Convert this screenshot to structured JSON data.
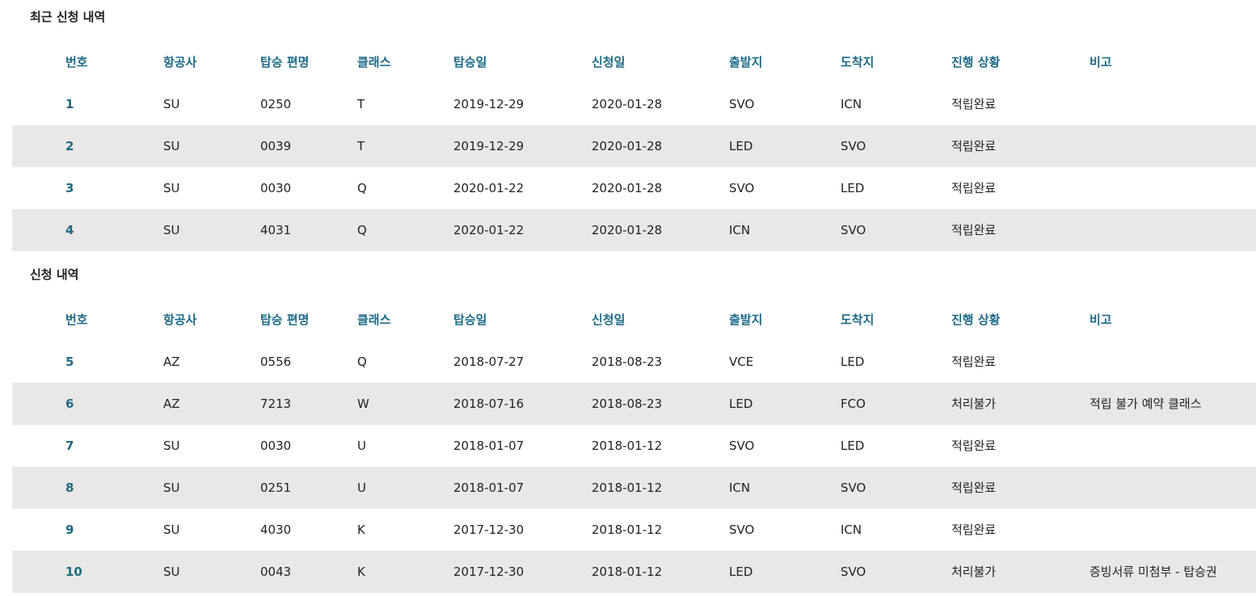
{
  "columns": [
    "번호",
    "항공사",
    "탑승 편명",
    "클래스",
    "탑승일",
    "신청일",
    "출발지",
    "도착지",
    "진행 상황",
    "비고"
  ],
  "recent": {
    "title": "최근 신청 내역",
    "rows": [
      {
        "no": "1",
        "airline": "SU",
        "flight": "0250",
        "class": "T",
        "boarding_date": "2019-12-29",
        "request_date": "2020-01-28",
        "origin": "SVO",
        "destination": "ICN",
        "status": "적립완료",
        "note": ""
      },
      {
        "no": "2",
        "airline": "SU",
        "flight": "0039",
        "class": "T",
        "boarding_date": "2019-12-29",
        "request_date": "2020-01-28",
        "origin": "LED",
        "destination": "SVO",
        "status": "적립완료",
        "note": ""
      },
      {
        "no": "3",
        "airline": "SU",
        "flight": "0030",
        "class": "Q",
        "boarding_date": "2020-01-22",
        "request_date": "2020-01-28",
        "origin": "SVO",
        "destination": "LED",
        "status": "적립완료",
        "note": ""
      },
      {
        "no": "4",
        "airline": "SU",
        "flight": "4031",
        "class": "Q",
        "boarding_date": "2020-01-22",
        "request_date": "2020-01-28",
        "origin": "ICN",
        "destination": "SVO",
        "status": "적립완료",
        "note": ""
      }
    ]
  },
  "history": {
    "title": "신청 내역",
    "rows": [
      {
        "no": "5",
        "airline": "AZ",
        "flight": "0556",
        "class": "Q",
        "boarding_date": "2018-07-27",
        "request_date": "2018-08-23",
        "origin": "VCE",
        "destination": "LED",
        "status": "적립완료",
        "note": ""
      },
      {
        "no": "6",
        "airline": "AZ",
        "flight": "7213",
        "class": "W",
        "boarding_date": "2018-07-16",
        "request_date": "2018-08-23",
        "origin": "LED",
        "destination": "FCO",
        "status": "처리불가",
        "note": "적립 불가 예약 클래스"
      },
      {
        "no": "7",
        "airline": "SU",
        "flight": "0030",
        "class": "U",
        "boarding_date": "2018-01-07",
        "request_date": "2018-01-12",
        "origin": "SVO",
        "destination": "LED",
        "status": "적립완료",
        "note": ""
      },
      {
        "no": "8",
        "airline": "SU",
        "flight": "0251",
        "class": "U",
        "boarding_date": "2018-01-07",
        "request_date": "2018-01-12",
        "origin": "ICN",
        "destination": "SVO",
        "status": "적립완료",
        "note": ""
      },
      {
        "no": "9",
        "airline": "SU",
        "flight": "4030",
        "class": "K",
        "boarding_date": "2017-12-30",
        "request_date": "2018-01-12",
        "origin": "SVO",
        "destination": "ICN",
        "status": "적립완료",
        "note": ""
      },
      {
        "no": "10",
        "airline": "SU",
        "flight": "0043",
        "class": "K",
        "boarding_date": "2017-12-30",
        "request_date": "2018-01-12",
        "origin": "LED",
        "destination": "SVO",
        "status": "처리불가",
        "note": "증빙서류 미첨부 - 탑승권"
      }
    ]
  }
}
